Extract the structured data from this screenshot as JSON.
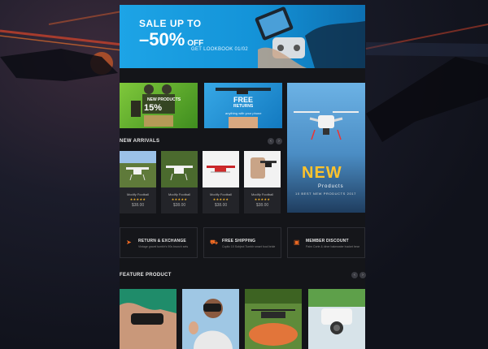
{
  "hero": {
    "line1": "SALE UP TO",
    "line2": "–50%",
    "off": "OFF",
    "sub": "GET LOOKBOOK 01/02"
  },
  "promos": {
    "tile1_small": "NEW PRODUCTS",
    "tile1_big": "15%",
    "tile2_big": "FREE",
    "tile2_small": "RETURNS",
    "tile2_caption": "anything with your phone",
    "tile3_big": "NEW",
    "tile3_sub": "Products",
    "tile3_caption": "10 BEST NEW PRODUCTS 2017"
  },
  "new_arrivals": {
    "title": "NEW ARRIVALS",
    "prev": "‹",
    "next": "›",
    "products": [
      {
        "name": "Modify Football",
        "stars": "★★★★★",
        "price": "$38.00"
      },
      {
        "name": "Modify Football",
        "stars": "★★★★★",
        "price": "$38.00"
      },
      {
        "name": "Modify Football",
        "stars": "★★★★★",
        "price": "$38.00"
      },
      {
        "name": "Modify Football",
        "stars": "★★★★★",
        "price": "$38.00"
      }
    ]
  },
  "services": [
    {
      "icon": "paper-plane-icon",
      "title": "RETURN & EXCHANGE",
      "desc": "Vintage gravel tumblr's 90s brunch sets"
    },
    {
      "icon": "truck-icon",
      "title": "FREE SHIPPING",
      "desc": "Coptic 10 Subject Tumblr smart food bride"
    },
    {
      "icon": "gift-icon",
      "title": "MEMBER DISCOUNT",
      "desc": "Palm Corte & diner bakewater bucket bear"
    }
  ],
  "feature": {
    "title": "FEATURE PRODUCT",
    "prev": "‹",
    "next": "›"
  },
  "colors": {
    "accent": "#ef6a23",
    "hero_blue": "#1da4e6",
    "star": "#f3b32a",
    "new_yellow": "#ffc32c"
  }
}
